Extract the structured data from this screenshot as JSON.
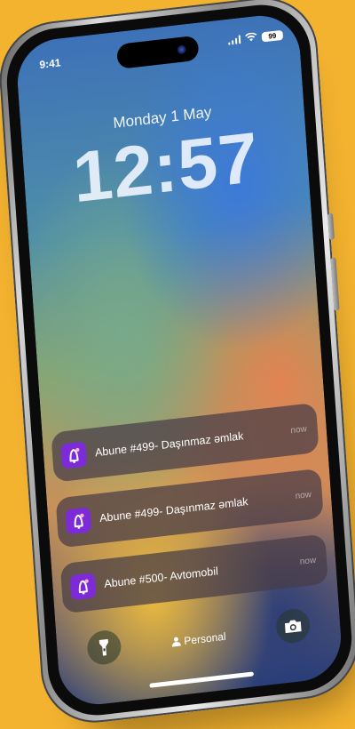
{
  "status_bar": {
    "time": "9:41",
    "battery": "99",
    "signal_icon": "cellular-signal-icon",
    "wifi_icon": "wifi-icon",
    "battery_icon": "battery-icon"
  },
  "lock_screen": {
    "date": "Monday  1 May",
    "time": "12:57"
  },
  "notifications": [
    {
      "text": "Abune #499- Daşınmaz əmlak",
      "time": "now",
      "icon": "app-bell-icon"
    },
    {
      "text": "Abune #499- Daşınmaz əmlak",
      "time": "now",
      "icon": "app-bell-icon"
    },
    {
      "text": "Abune #500- Avtomobil",
      "time": "now",
      "icon": "app-bell-icon"
    }
  ],
  "bottom": {
    "focus_label": "Personal",
    "flashlight_icon": "flashlight-icon",
    "camera_icon": "camera-icon",
    "person_icon": "person-icon"
  },
  "colors": {
    "background": "#F4B32F",
    "app_icon": "#7D2BD9"
  }
}
